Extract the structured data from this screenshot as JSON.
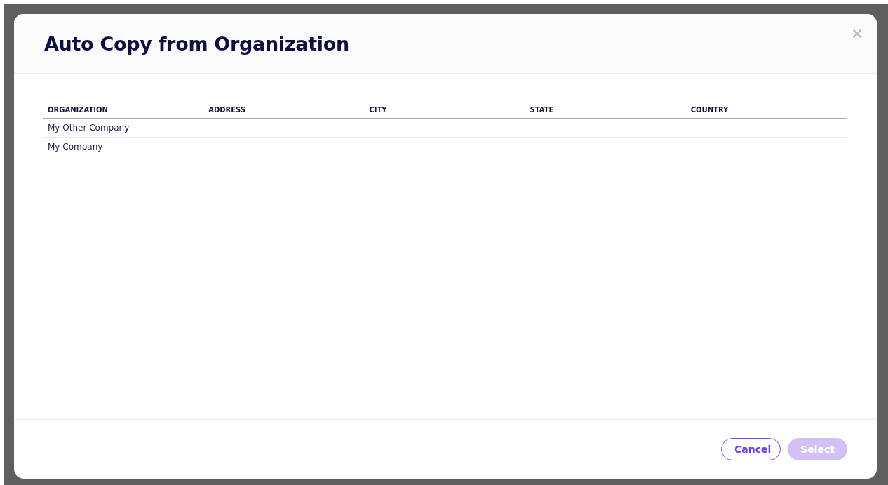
{
  "dialog": {
    "title": "Auto Copy from Organization"
  },
  "table": {
    "columns": [
      "ORGANIZATION",
      "ADDRESS",
      "CITY",
      "STATE",
      "COUNTRY"
    ],
    "rows": [
      {
        "organization": "My Other Company"
      },
      {
        "organization": "My Company"
      }
    ]
  },
  "buttons": [
    {
      "label": "Cancel",
      "kind": "secondary",
      "disabled": false
    },
    {
      "label": "Select",
      "kind": "primary",
      "disabled": true
    }
  ]
}
